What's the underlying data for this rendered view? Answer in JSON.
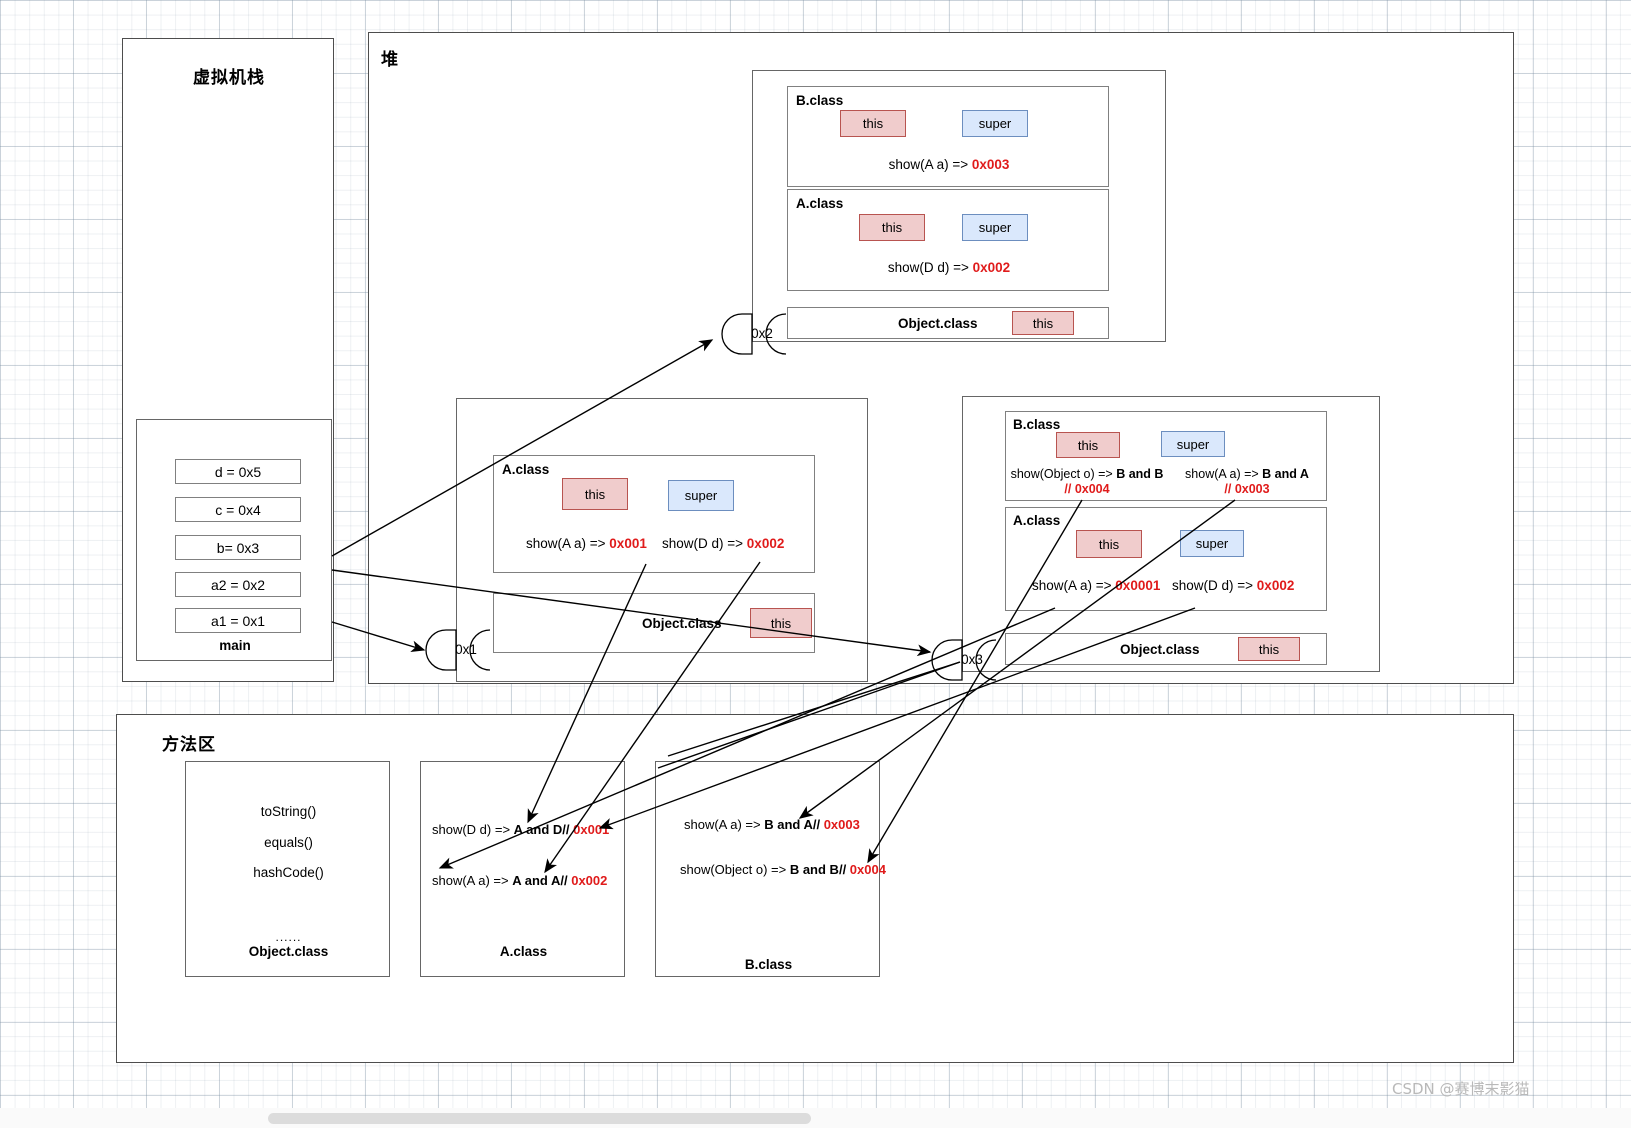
{
  "diagram": {
    "title_stack": "虚拟机栈",
    "title_heap": "堆",
    "title_method_area": "方法区"
  },
  "stack": {
    "frame_label": "main",
    "variables": [
      {
        "text": "d = 0x5"
      },
      {
        "text": "c = 0x4"
      },
      {
        "text": "b= 0x3"
      },
      {
        "text": "a2 = 0x2"
      },
      {
        "text": "a1 = 0x1"
      }
    ]
  },
  "heap": {
    "objects": [
      {
        "ref": "0x2",
        "layers": [
          {
            "class_name": "B.class",
            "this_label": "this",
            "super_label": "super",
            "methods": [
              {
                "sig": "show(A a) => ",
                "addr": "0x003"
              }
            ]
          },
          {
            "class_name": "A.class",
            "this_label": "this",
            "super_label": "super",
            "methods": [
              {
                "sig": "show(D d) => ",
                "addr": "0x002"
              }
            ]
          }
        ],
        "object_class": {
          "label": "Object.class",
          "this_label": "this"
        }
      },
      {
        "ref": "0x1",
        "layers": [
          {
            "class_name": "A.class",
            "this_label": "this",
            "super_label": "super",
            "methods": [
              {
                "sig": "show(A a) => ",
                "addr": "0x001"
              },
              {
                "sig": "show(D d) => ",
                "addr": "0x002"
              }
            ]
          }
        ],
        "object_class": {
          "label": "Object.class",
          "this_label": "this"
        }
      },
      {
        "ref": "0x3",
        "layers": [
          {
            "class_name": "B.class",
            "this_label": "this",
            "super_label": "super",
            "methods": [
              {
                "sig": "show(Object o) => ",
                "bold": "B and B",
                "comment": "// 0x004"
              },
              {
                "sig": "show(A a) => ",
                "bold": "B and A",
                "comment": "// 0x003"
              }
            ]
          },
          {
            "class_name": "A.class",
            "this_label": "this",
            "super_label": "super",
            "methods": [
              {
                "sig": "show(A a) => ",
                "addr": "0x0001"
              },
              {
                "sig": "show(D d) => ",
                "addr": "0x002"
              }
            ]
          }
        ],
        "object_class": {
          "label": "Object.class",
          "this_label": "this"
        }
      }
    ]
  },
  "method_area": {
    "classes": [
      {
        "name": "Object.class",
        "dots": "......",
        "methods": [
          "toString()",
          "equals()",
          "hashCode()"
        ]
      },
      {
        "name": "A.class",
        "entries": [
          {
            "sig": "show(D d) => ",
            "bold": "A and D",
            "comment": "// ",
            "addr": "0x001"
          },
          {
            "sig": "show(A a) => ",
            "bold": "A and A",
            "comment": "// ",
            "addr": "0x002"
          }
        ]
      },
      {
        "name": "B.class",
        "entries": [
          {
            "sig": "show(A a) => ",
            "bold": "B and A",
            "comment": "// ",
            "addr": "0x003"
          },
          {
            "sig": "show(Object o) => ",
            "bold": "B and B",
            "comment": "// ",
            "addr": "0x004"
          }
        ]
      }
    ]
  },
  "watermark": {
    "text": "CSDN @赛博末影猫"
  },
  "colors": {
    "this_fill": "#f0cccc",
    "this_stroke": "#b85450",
    "super_fill": "#dae8fc",
    "super_stroke": "#6c8ebf",
    "address_red": "#e01b1b",
    "panel_stroke": "#4d4d4d"
  }
}
